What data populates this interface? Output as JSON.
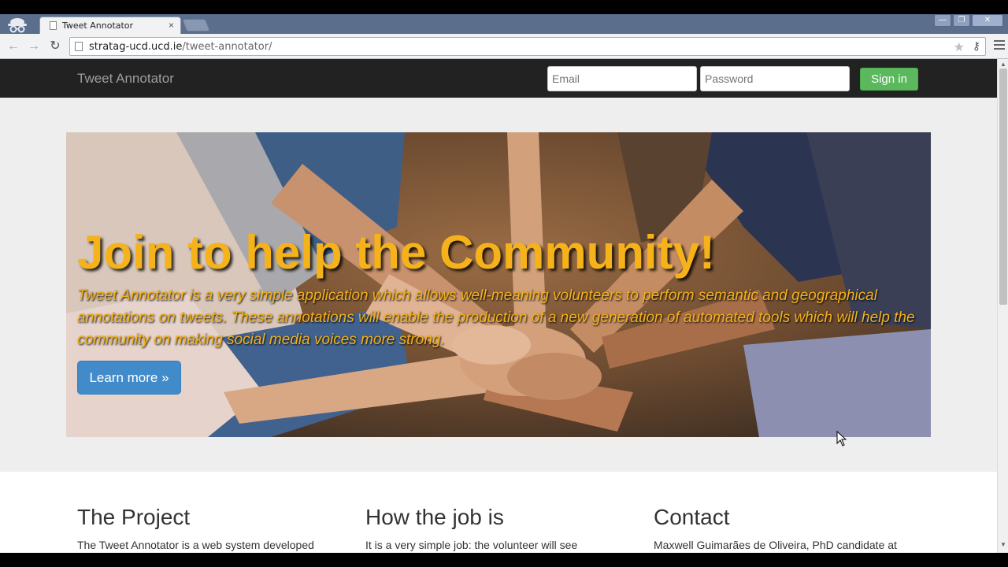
{
  "browser": {
    "tab_title": "Tweet Annotator",
    "tab_close": "×",
    "url_domain": "stratag-ucd.ucd.ie",
    "url_path": "/tweet-annotator/",
    "window_buttons": [
      "—",
      "❐",
      "✕"
    ]
  },
  "navbar": {
    "brand": "Tweet Annotator",
    "email_placeholder": "Email",
    "password_placeholder": "Password",
    "signin_label": "Sign in"
  },
  "hero": {
    "title": "Join to help the Community!",
    "text": "Tweet Annotator is a very simple application which allows well-meaning volunteers to perform semantic and geographical annotations on tweets. These annotations will enable the production of a new generation of automated tools which will help the community on making social media voices more strong.",
    "button_label": "Learn more »",
    "accent_color": "#f5b21a"
  },
  "columns": [
    {
      "heading": "The Project",
      "text": "The Tweet Annotator is a web system developed"
    },
    {
      "heading": "How the job is",
      "text": "It is a very simple job: the volunteer will see"
    },
    {
      "heading": "Contact",
      "text": "Maxwell Guimarães de Oliveira, PhD candidate at"
    }
  ]
}
